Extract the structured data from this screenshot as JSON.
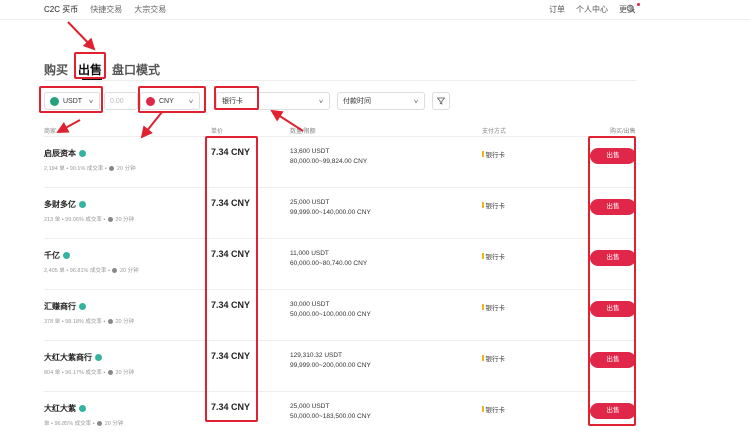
{
  "nav": {
    "left": [
      "C2C 买币",
      "快捷交易",
      "大宗交易"
    ],
    "right": [
      "订单",
      "个人中心",
      "更多"
    ]
  },
  "tabs": [
    "购买",
    "出售",
    "盘口模式"
  ],
  "filters": {
    "coin": "USDT",
    "amount_placeholder": "0.00",
    "fiat": "CNY",
    "payment": "银行卡",
    "time": "付款时间"
  },
  "headers": {
    "merchant": "商家",
    "price": "单价",
    "qty_limit": "数量/限额",
    "payment": "支付方式",
    "action": "购买/出售"
  },
  "rows": [
    {
      "merchant": "启辰资本",
      "stats": "2,194 单 • 90.1% 成交率 •",
      "time": "20 分钟",
      "price": "7.34 CNY",
      "qty": "13,600 USDT",
      "limit": "80,000.00~99,824.00 CNY",
      "pay": "银行卡",
      "action": "出售"
    },
    {
      "merchant": "多财多亿",
      "stats": "213 单 • 99.06% 成交率 •",
      "time": "20 分钟",
      "price": "7.34 CNY",
      "qty": "25,000 USDT",
      "limit": "99,999.00~140,000.00 CNY",
      "pay": "银行卡",
      "action": "出售"
    },
    {
      "merchant": "千亿",
      "stats": "2,405 单 • 96.81% 成交率 •",
      "time": "20 分钟",
      "price": "7.34 CNY",
      "qty": "11,000 USDT",
      "limit": "60,000.00~80,740.00 CNY",
      "pay": "银行卡",
      "action": "出售"
    },
    {
      "merchant": "汇赚商行",
      "stats": "378 单 • 98.18% 成交率 •",
      "time": "20 分钟",
      "price": "7.34 CNY",
      "qty": "30,000 USDT",
      "limit": "50,000.00~100,000.00 CNY",
      "pay": "银行卡",
      "action": "出售"
    },
    {
      "merchant": "大红大紫商行",
      "stats": "804 单 • 96.17% 成交率 •",
      "time": "20 分钟",
      "price": "7.34 CNY",
      "qty": "129,310.32 USDT",
      "limit": "99,999.00~200,000.00 CNY",
      "pay": "银行卡",
      "action": "出售"
    },
    {
      "merchant": "大红大紫",
      "stats": "单 • 96.85% 成交率 •",
      "time": "20 分钟",
      "price": "7.34 CNY",
      "qty": "25,000 USDT",
      "limit": "50,000.00~183,500.00 CNY",
      "pay": "银行卡",
      "action": "出售"
    }
  ],
  "colors": {
    "accent": "#e0274a",
    "annotation": "#e0212f",
    "usdt_coin": "#26a17b",
    "cny_coin": "#e0274a",
    "verified": "#36b3a0"
  }
}
